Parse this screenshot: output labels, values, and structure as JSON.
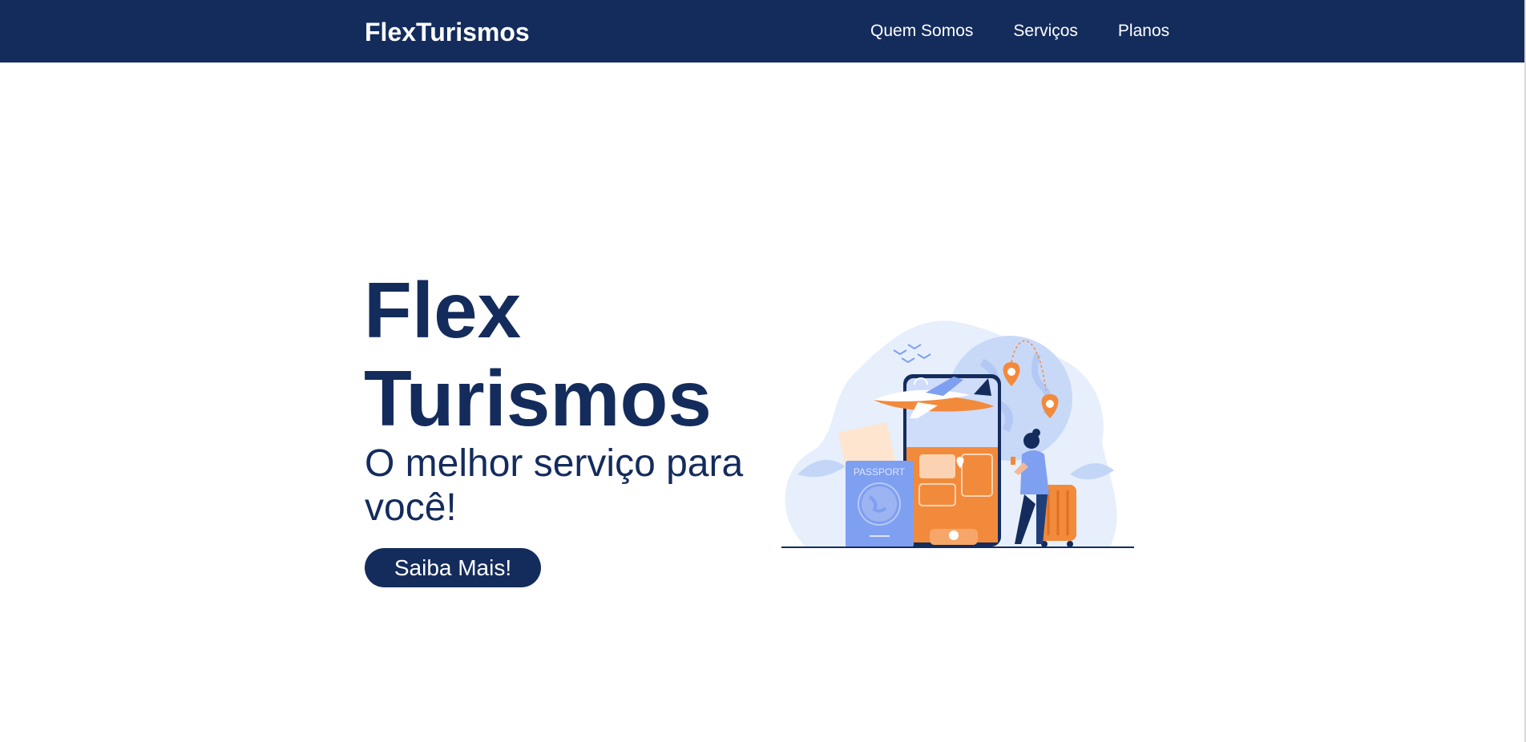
{
  "header": {
    "brand": "FlexTurismos",
    "nav": [
      {
        "label": "Quem Somos"
      },
      {
        "label": "Serviços"
      },
      {
        "label": "Planos"
      }
    ]
  },
  "hero": {
    "title_line1": "Flex",
    "title_line2": "Turismos",
    "subtitle": "O melhor serviço para você!",
    "cta_label": "Saiba Mais!"
  },
  "illustration": {
    "passport_text": "PASSPORT",
    "icon": "travel-illustration"
  },
  "colors": {
    "primary": "#142c5c",
    "accent": "#f28a3c",
    "light_blue": "#dde8fb",
    "mid_blue": "#7f9ff0"
  }
}
